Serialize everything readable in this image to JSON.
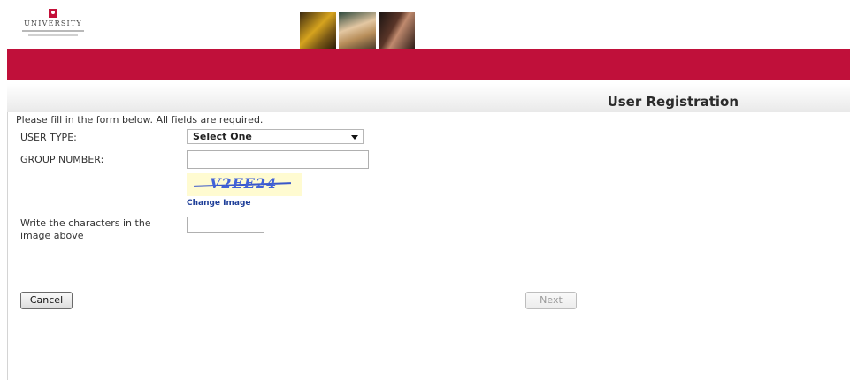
{
  "header": {
    "logo_text": "UNIVERSITY",
    "logo_mark": "university-shield-icon",
    "brand_color": "#c0103a"
  },
  "page": {
    "title": "User Registration",
    "instructions": "Please fill in the form below.  All fields are required."
  },
  "form": {
    "user_type_label": "USER TYPE:",
    "user_type_value": "Select One",
    "group_number_label": "GROUP NUMBER:",
    "group_number_value": "",
    "captcha_text": "V2EE24",
    "change_image_link": "Change Image",
    "captcha_label": "Write the characters in the image above",
    "captcha_value": ""
  },
  "actions": {
    "cancel_label": "Cancel",
    "next_label": "Next",
    "next_enabled": false
  }
}
